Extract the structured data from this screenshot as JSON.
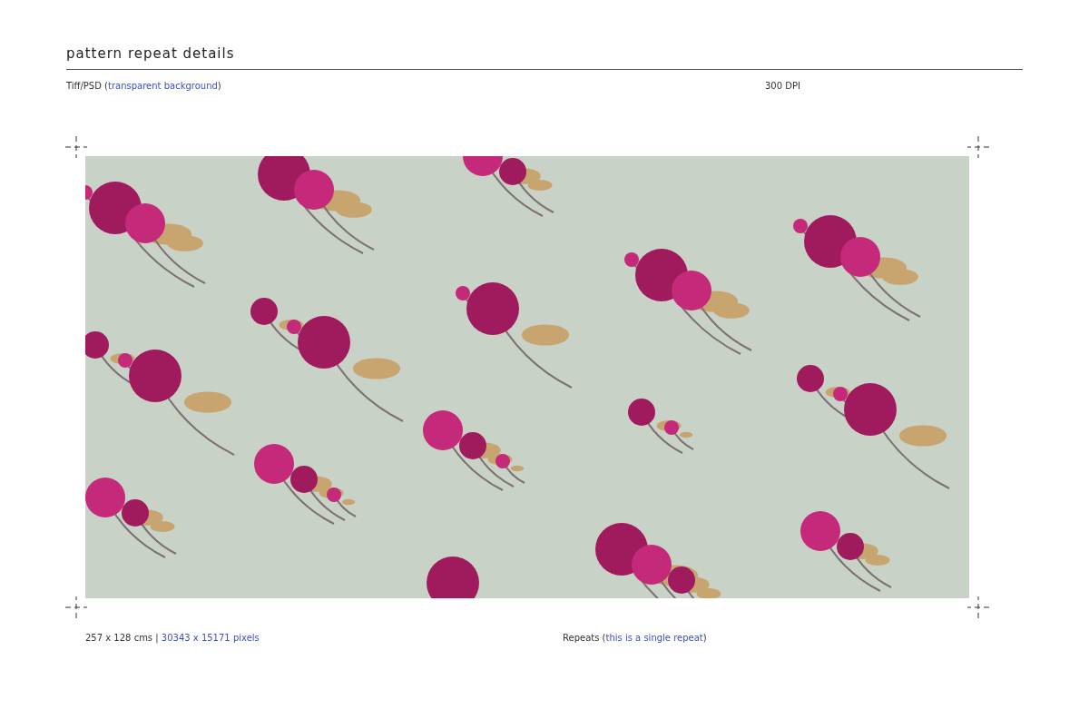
{
  "title": "pattern repeat details",
  "format": {
    "prefix": "Tiff/PSD (",
    "link": "transparent background",
    "suffix": ")"
  },
  "resolution": "300 DPI",
  "size": {
    "prefix": "257 x 128 cms | ",
    "link": "30343 x 15171 pixels"
  },
  "repeats": {
    "prefix": "Repeats (",
    "link": "this is a single repeat",
    "suffix": ")"
  }
}
